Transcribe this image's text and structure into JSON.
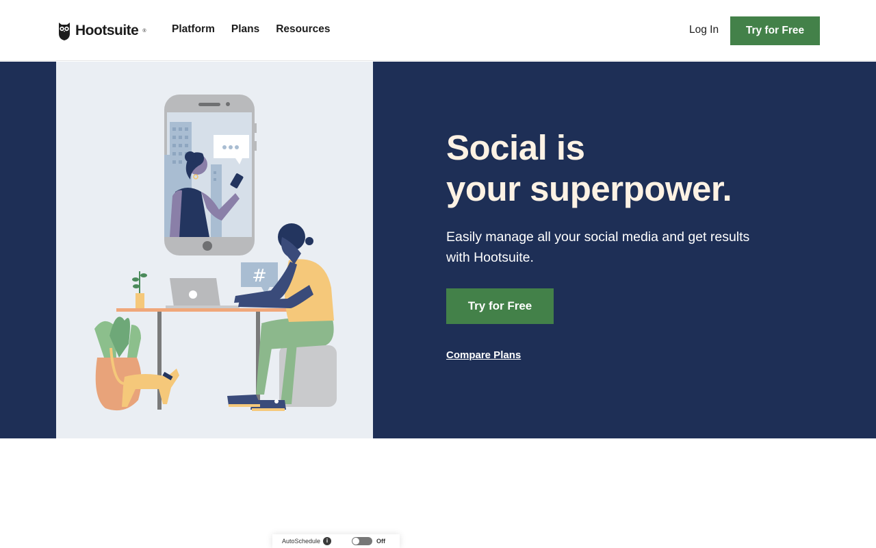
{
  "header": {
    "logo_text": "Hootsuite",
    "logo_mark": "®",
    "nav": [
      {
        "label": "Platform"
      },
      {
        "label": "Plans"
      },
      {
        "label": "Resources"
      }
    ],
    "login_label": "Log In",
    "cta_label": "Try for Free"
  },
  "hero": {
    "headline_line1": "Social is",
    "headline_line2": "your superpower.",
    "subcopy": "Easily manage all your social media and get results with Hootsuite.",
    "cta_label": "Try for Free",
    "compare_label": "Compare Plans",
    "illustration": {
      "icon": "person-at-desk-illustration",
      "chat_bubble_text": "•••",
      "hashtag_text": "#"
    }
  },
  "peek": {
    "autoschedule_label": "AutoSchedule",
    "info_icon": "i",
    "toggle_state": "off",
    "toggle_label": "Off"
  },
  "colors": {
    "brand_green": "#438149",
    "hero_navy": "#1e2f56",
    "headline_cream": "#fdf2e4",
    "illustration_bg": "#eaeef3"
  }
}
